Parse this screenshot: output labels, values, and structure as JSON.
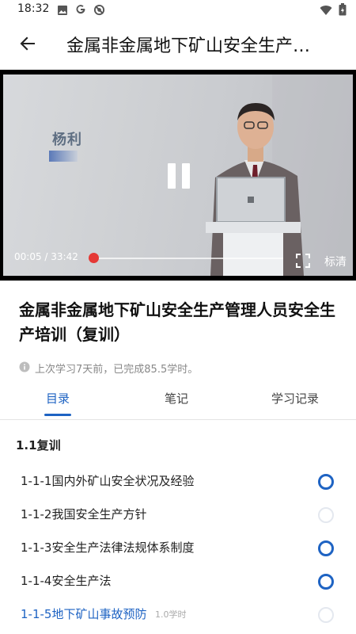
{
  "status_bar": {
    "time": "18:32",
    "left_icons": [
      "image-icon",
      "google-icon",
      "no-tracking-icon"
    ],
    "right_icons": [
      "wifi-icon",
      "battery-icon"
    ]
  },
  "app_bar": {
    "title": "金属非金属地下矿山安全生产…",
    "back_icon": "arrow-left-icon"
  },
  "video": {
    "speaker_name": "杨利",
    "time": "00:05 / 33:42",
    "progress": 0.0025,
    "quality": "标清",
    "state": "playing"
  },
  "course": {
    "title": "金属非金属地下矿山安全生产管理人员安全生产培训（复训）",
    "info": "上次学习7天前，已完成85.5学时。"
  },
  "tabs": [
    {
      "label": "目录",
      "active": true
    },
    {
      "label": "笔记",
      "active": false
    },
    {
      "label": "学习记录",
      "active": false
    }
  ],
  "catalog": {
    "section": "1.1复训",
    "lessons": [
      {
        "label": "1-1-1国内外矿山安全状况及经验",
        "hours": "",
        "status": "ring"
      },
      {
        "label": "1-1-2我国安全生产方针",
        "hours": "",
        "status": "faint"
      },
      {
        "label": "1-1-3安全生产法律法规体系制度",
        "hours": "",
        "status": "ring"
      },
      {
        "label": "1-1-4安全生产法",
        "hours": "",
        "status": "ring"
      },
      {
        "label": "1-1-5地下矿山事故预防",
        "hours": "1.0学时",
        "status": "faint"
      }
    ]
  },
  "colors": {
    "accent": "#1e63c3",
    "progress": "#e53935"
  }
}
